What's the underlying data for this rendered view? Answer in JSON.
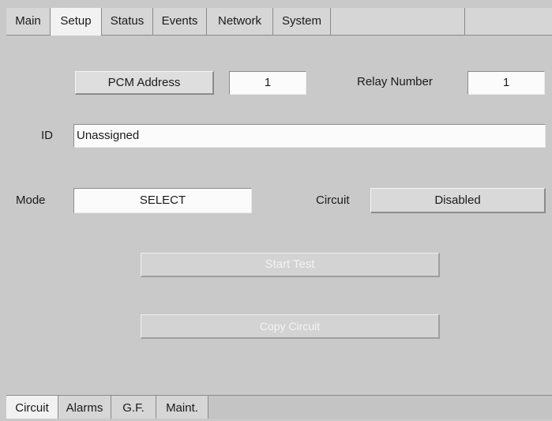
{
  "top_tabs": [
    {
      "label": "Main"
    },
    {
      "label": "Setup"
    },
    {
      "label": "Status"
    },
    {
      "label": "Events"
    },
    {
      "label": "Network"
    },
    {
      "label": "System"
    }
  ],
  "active_top_tab": "Setup",
  "setup": {
    "pcm_address_label": "PCM Address",
    "pcm_address_value": "1",
    "relay_number_label": "Relay Number",
    "relay_number_value": "1",
    "id_label": "ID",
    "id_value": "Unassigned",
    "mode_label": "Mode",
    "mode_value": "SELECT",
    "circuit_label": "Circuit",
    "circuit_value": "Disabled",
    "start_test_label": "Start Test",
    "copy_circuit_label": "Copy Circuit"
  },
  "bottom_tabs": [
    {
      "label": "Circuit"
    },
    {
      "label": "Alarms"
    },
    {
      "label": "G.F."
    },
    {
      "label": "Maint."
    }
  ],
  "active_bottom_tab": "Circuit"
}
